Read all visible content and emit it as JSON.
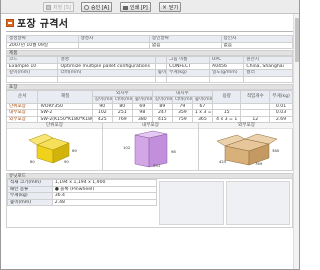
{
  "toolbar": {
    "save_label": "저장 [S]",
    "approve_label": "승인 [A]",
    "print_label": "인쇄 [P]",
    "close_label": "닫기"
  },
  "page": {
    "title": "포장 규격서"
  },
  "meta": {
    "labels": [
      "생성날짜",
      "생성자",
      "승인날짜",
      "승인자"
    ],
    "values": [
      "2007년 10월 09일",
      "",
      "없음",
      "없음"
    ]
  },
  "product": {
    "section": "제품",
    "labels": [
      "코드",
      "설명",
      "",
      "그룹 이름",
      "UPC",
      "원산지"
    ],
    "values": [
      "Example 10",
      "Optimize multiple pallet configurations",
      "",
      "CONFECT",
      "A0456",
      "China, Shanghai"
    ],
    "dim_labels": [
      "깊이(mm)",
      "너비(mm)",
      "높이(mm)",
      "무게(kg)",
      "밀도(g/mm)",
      "컬러"
    ],
    "dim_values": [
      "",
      "",
      "",
      "",
      "",
      ""
    ]
  },
  "packaging": {
    "section": "포장",
    "group_outer": "외치수",
    "group_inner": "내치수",
    "headers": [
      "순서",
      "재질",
      "길이(mm)",
      "너비(mm)",
      "높이(mm)",
      "길이(mm)",
      "너비(mm)",
      "높이(mm)",
      "용량",
      "적입개수",
      "무게(kg)"
    ],
    "rows": [
      {
        "label": "단위포장",
        "cells": [
          "IVORY350",
          "90",
          "80",
          "69",
          "89",
          "79",
          "67",
          "",
          "",
          "0.01"
        ]
      },
      {
        "label": "내부포장",
        "cells": [
          "SW-2",
          "102",
          "251",
          "98",
          "247",
          "359",
          "1 x 3 = 5",
          "15",
          "",
          "0.03"
        ]
      },
      {
        "label": "외부포장",
        "cells": [
          "SW-2(K150*K180*K180)",
          "425",
          "769",
          "380",
          "415",
          "759",
          "365",
          "4 x 3 = 1",
          "12",
          "2.69"
        ]
      }
    ]
  },
  "images": {
    "labels": [
      "단위포장",
      "내부포장",
      "외부포장"
    ],
    "dims": {
      "unit": [
        "80",
        "90",
        "69"
      ],
      "inner": [
        "102",
        "251",
        "98"
      ],
      "outer": [
        "425",
        "769",
        "380"
      ]
    }
  },
  "logistics": {
    "section": "유닛로드",
    "labels": [
      "적재 크기(mm)",
      "패턴 종류",
      "무게(kg)",
      "높이(mm)"
    ],
    "values": [
      "1,194 x 1,194 x 1,900",
      "● 블록 (Pinwheel)",
      "36.4",
      "2.48"
    ]
  },
  "colors": {
    "accent": "#d96a1e",
    "header_bg": "#e9edf3",
    "section_bg": "#e2e2e2",
    "box_yellow": "#f0d21c",
    "box_purple": "#d3a7e6",
    "box_tan": "#d8b07a"
  }
}
